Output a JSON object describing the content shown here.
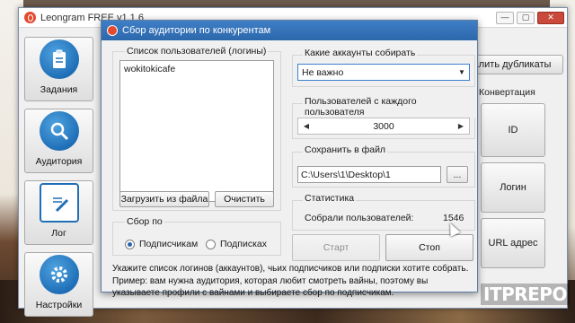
{
  "main_window": {
    "title": "Leongram FREE v1.1.6",
    "controls": [
      "—",
      "▢",
      "✕"
    ]
  },
  "sidebar": {
    "items": [
      {
        "label": "Задания",
        "icon": "clipboard-icon"
      },
      {
        "label": "Аудитория",
        "icon": "magnifier-icon"
      },
      {
        "label": "Лог",
        "icon": "document-pencil-icon"
      },
      {
        "label": "Настройки",
        "icon": "gear-icon"
      }
    ]
  },
  "background_panel": {
    "remove_duplicates": "алить дубликаты",
    "conversion_label": "Конвертация",
    "id_button": "ID",
    "login_button": "Логин",
    "url_button": "URL адрес"
  },
  "dialog": {
    "title": "Сбор аудитории по конкурентам",
    "users_list": {
      "label": "Список пользователей (логины)",
      "items": [
        "wokitokicafe"
      ],
      "load_button": "Загрузить из файла",
      "clear_button": "Очистить"
    },
    "collect_by": {
      "label": "Сбор по",
      "options": [
        {
          "label": "Подписчикам",
          "checked": true
        },
        {
          "label": "Подписках",
          "checked": false
        }
      ]
    },
    "accounts": {
      "label": "Какие аккаунты собирать",
      "selected": "Не важно"
    },
    "per_user": {
      "label": "Пользователей с каждого пользователя",
      "value": "3000"
    },
    "save_file": {
      "label": "Сохранить в файл",
      "path": "C:\\Users\\1\\Desktop\\1",
      "browse_button": "..."
    },
    "stats": {
      "label": "Статистика",
      "collected_label": "Собрали пользователей:",
      "collected_value": "1546"
    },
    "start_button": "Старт",
    "stop_button": "Стоп",
    "hint": "Укажите список логинов (аккаунтов), чьих подписчиков или подписки хотите собрать. Пример: вам нужна аудитория, которая любит смотреть вайны, поэтому вы указываете профили с вайнами и выбираете сбор по подписчикам."
  },
  "watermark": "ITPREPO",
  "colors": {
    "dialog_titlebar": "#2c67ab",
    "logo_accent": "#e34a2e",
    "icon_blue": "#1f6fb7"
  }
}
